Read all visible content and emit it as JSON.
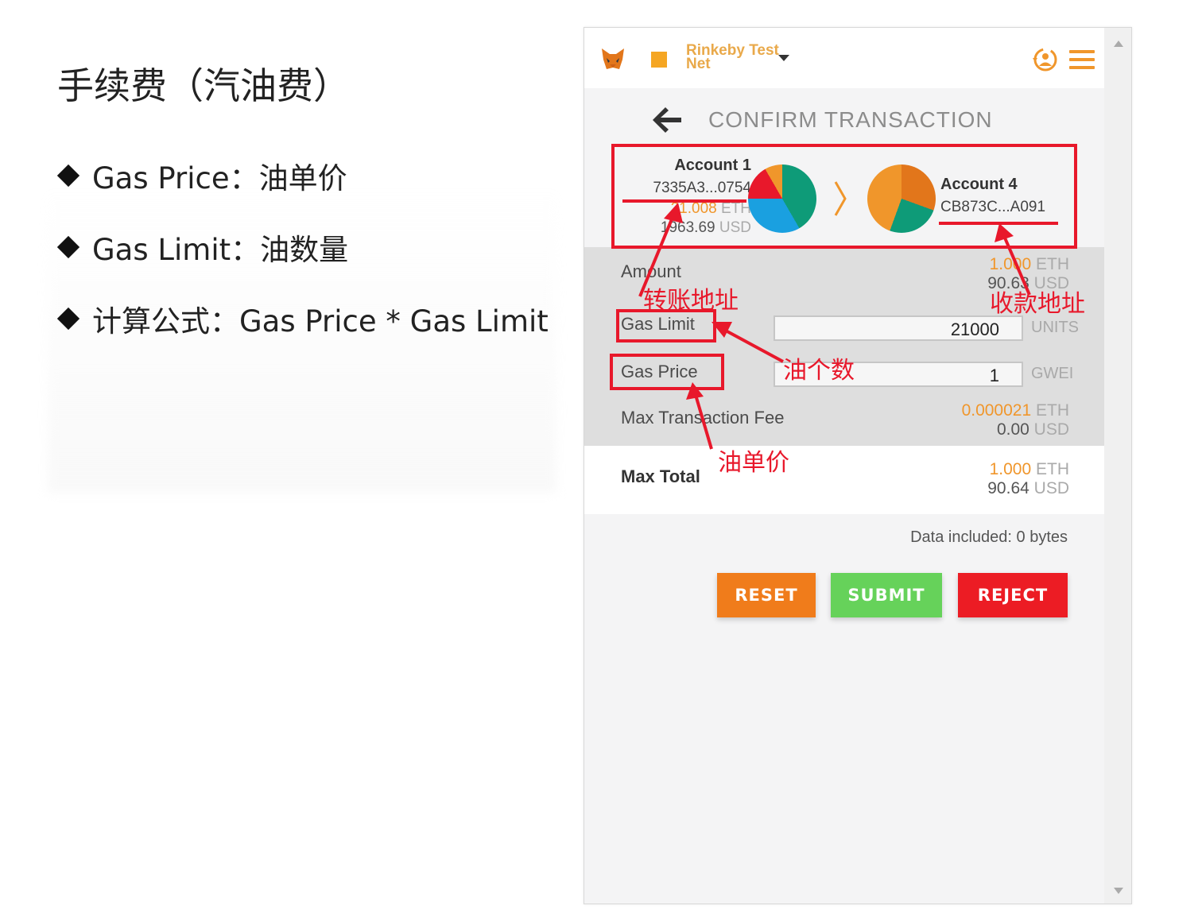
{
  "slide": {
    "title": "手续费（汽油费）",
    "bullets": [
      "Gas Price：油单价",
      "Gas Limit：油数量",
      "计算公式：Gas Price * Gas Limit"
    ]
  },
  "header": {
    "network_name": "Rinkeby Test Net",
    "network_color": "#f5a623",
    "icons": [
      "metamask-fox-icon",
      "account-icon",
      "hamburger-menu-icon",
      "caret-down-icon"
    ]
  },
  "page": {
    "title": "CONFIRM TRANSACTION"
  },
  "from_account": {
    "name": "Account 1",
    "address": "7335A3...0754",
    "eth_value": "21.008",
    "eth_unit": "ETH",
    "usd_value": "1963.69",
    "usd_unit": "USD"
  },
  "to_account": {
    "name": "Account 4",
    "address": "CB873C...A091"
  },
  "details": {
    "amount_label": "Amount",
    "amount_eth": "1.000",
    "amount_eth_unit": "ETH",
    "amount_usd": "90.63",
    "amount_usd_unit": "USD",
    "gas_limit_label": "Gas Limit",
    "gas_limit_value": "21000",
    "gas_limit_unit": "UNITS",
    "gas_price_label": "Gas Price",
    "gas_price_value": "1",
    "gas_price_unit": "GWEI",
    "max_fee_label": "Max Transaction Fee",
    "max_fee_eth": "0.000021",
    "max_fee_eth_unit": "ETH",
    "max_fee_usd": "0.00",
    "max_fee_usd_unit": "USD",
    "max_total_label": "Max Total",
    "max_total_eth": "1.000",
    "max_total_eth_unit": "ETH",
    "max_total_usd": "90.64",
    "max_total_usd_unit": "USD"
  },
  "data_included": "Data included: 0 bytes",
  "buttons": {
    "reset": "RESET",
    "submit": "SUBMIT",
    "reject": "REJECT",
    "reset_color": "#f07c1b",
    "submit_color": "#66d25a",
    "reject_color": "#ec1c24"
  },
  "annotations": {
    "from_address": "转账地址",
    "to_address": "收款地址",
    "gas_limit": "油个数",
    "gas_price": "油单价",
    "color": "#e8182b"
  }
}
